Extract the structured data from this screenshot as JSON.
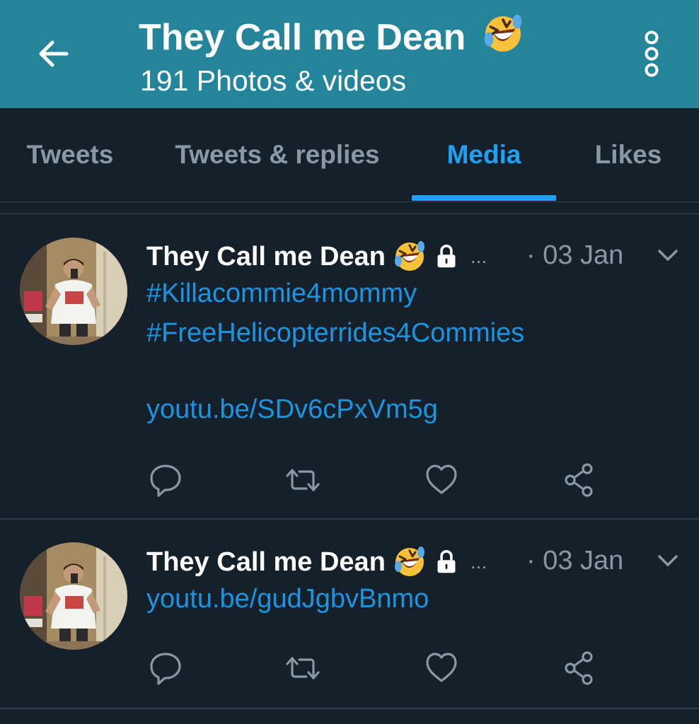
{
  "header": {
    "title": "They Call me Dean",
    "title_emoji": "rofl-emoji",
    "subtitle": "191 Photos & videos",
    "back_icon": "arrow-left-icon",
    "more_icon": "more-vertical-icon",
    "background_color": "#23849a"
  },
  "tabs": [
    {
      "label": "Tweets",
      "active": false
    },
    {
      "label": "Tweets & replies",
      "active": false
    },
    {
      "label": "Media",
      "active": true
    },
    {
      "label": "Likes",
      "active": false
    }
  ],
  "colors": {
    "background": "#15202b",
    "accent": "#1da1f2",
    "link": "#1b95e0",
    "muted": "#8899a6",
    "divider": "#2f3e4c"
  },
  "tweets": [
    {
      "author": "They Call me Dean",
      "ellipsis": "...",
      "date": "· 03 Jan",
      "lines": [
        "#Killacommie4mommy",
        "#FreeHelicopterrides4Commies",
        "",
        "youtu.be/SDv6cPxVm5g"
      ]
    },
    {
      "author": "They Call me Dean",
      "ellipsis": "...",
      "date": "· 03 Jan",
      "lines": [
        "youtu.be/gudJgbvBnmo"
      ]
    }
  ],
  "action_icons": [
    "reply-icon",
    "retweet-icon",
    "like-icon",
    "share-icon"
  ]
}
